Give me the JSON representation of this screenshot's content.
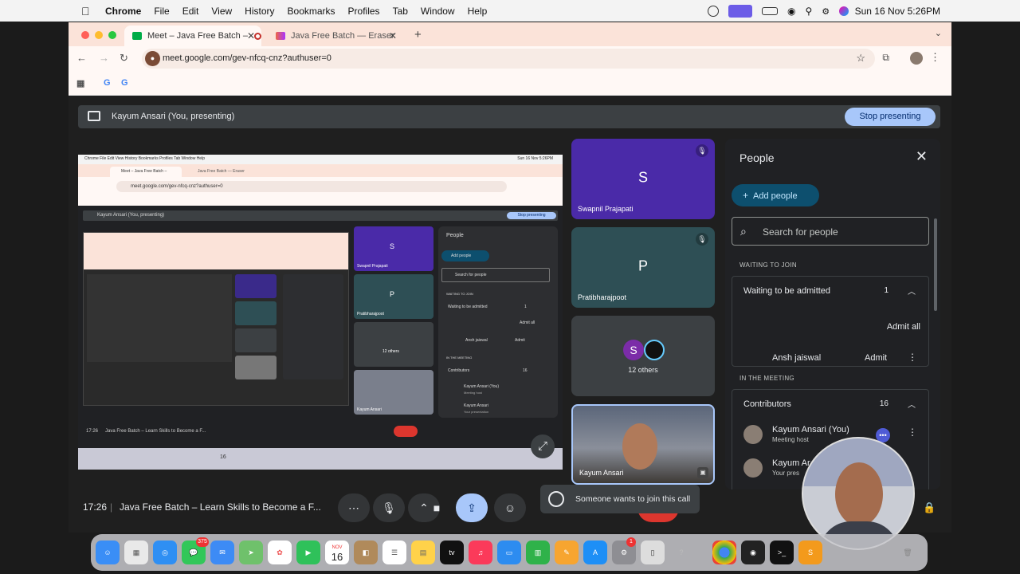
{
  "menubar": {
    "app": "Chrome",
    "items": [
      "File",
      "Edit",
      "View",
      "History",
      "Bookmarks",
      "Profiles",
      "Tab",
      "Window",
      "Help"
    ],
    "clock": "Sun 16 Nov  5:26PM"
  },
  "browser": {
    "tabs": [
      {
        "label": "Meet – Java Free Batch –",
        "active": true
      },
      {
        "label": "Java Free Batch — Eraser",
        "active": false
      }
    ],
    "url": "meet.google.com/gev-nfcq-cnz?authuser=0"
  },
  "meet": {
    "presenting_label": "Kayum Ansari (You, presenting)",
    "stop_presenting": "Stop presenting",
    "time": "17:26",
    "meeting_title": "Java Free Batch – Learn Skills to Become a F...",
    "toast": "Someone wants to join this call",
    "tiles": [
      {
        "name": "Swapnil Prajapati",
        "initial": "S",
        "color": "#4a2aa8"
      },
      {
        "name": "Pratibharajpoot",
        "initial": "P",
        "color": "#2e4f55"
      },
      {
        "name": "12 others",
        "initial": "S",
        "color": "#3c4043"
      },
      {
        "name": "Kayum Ansari",
        "initial": "",
        "color": "#6b6f7a"
      }
    ],
    "mini": {
      "menu": "Chrome  File  Edit  View  History  Bookmarks  Profiles  Tab  Window  Help",
      "clock": "Sun 16 Nov 5:26PM",
      "tab1": "Meet – Java Free Batch –",
      "tab2": "Java Free Batch — Eraser",
      "url": "meet.google.com/gev-nfcq-cnz?authuser=0",
      "presenting": "Kayum Ansari (You, presenting)",
      "stop": "Stop presenting",
      "people": "People",
      "add_people": "Add people",
      "search": "Search for people",
      "waiting_section": "WAITING TO JOIN",
      "waiting": "Waiting to be admitted",
      "waiting_count": "1",
      "admit_all": "Admit all",
      "guest": "Ansh jaiswal",
      "admit": "Admit",
      "in_meeting": "IN THE MEETING",
      "contributors": "Contributors",
      "contributors_count": "16",
      "host": "Kayum Ansari (You)",
      "host_role": "Meeting host",
      "presenter": "Kayum Ansari",
      "presenter_role": "Your presentation",
      "tile1": "Swapnil Prajapati",
      "tile2": "Pratibharajpoot",
      "tile3": "12 others",
      "tile4": "Kayum Ansari",
      "time": "17:26",
      "title": "Java Free Batch – Learn Skills to Become a F...",
      "dock_date": "16"
    }
  },
  "people": {
    "title": "People",
    "add_people": "Add people",
    "search_placeholder": "Search for people",
    "waiting_section": "WAITING TO JOIN",
    "waiting_group": "Waiting to be admitted",
    "waiting_count": "1",
    "admit_all": "Admit all",
    "waiting_person": "Ansh jaiswal",
    "admit": "Admit",
    "meeting_section": "IN THE MEETING",
    "contributors": "Contributors",
    "contributors_count": "16",
    "host_name": "Kayum Ansari (You)",
    "host_role": "Meeting host",
    "second_name": "Kayum Ar",
    "second_role": "Your pres"
  },
  "dock": {
    "messages_badge": "375",
    "calendar_month": "NOV",
    "calendar_day": "16",
    "settings_badge": "1"
  }
}
